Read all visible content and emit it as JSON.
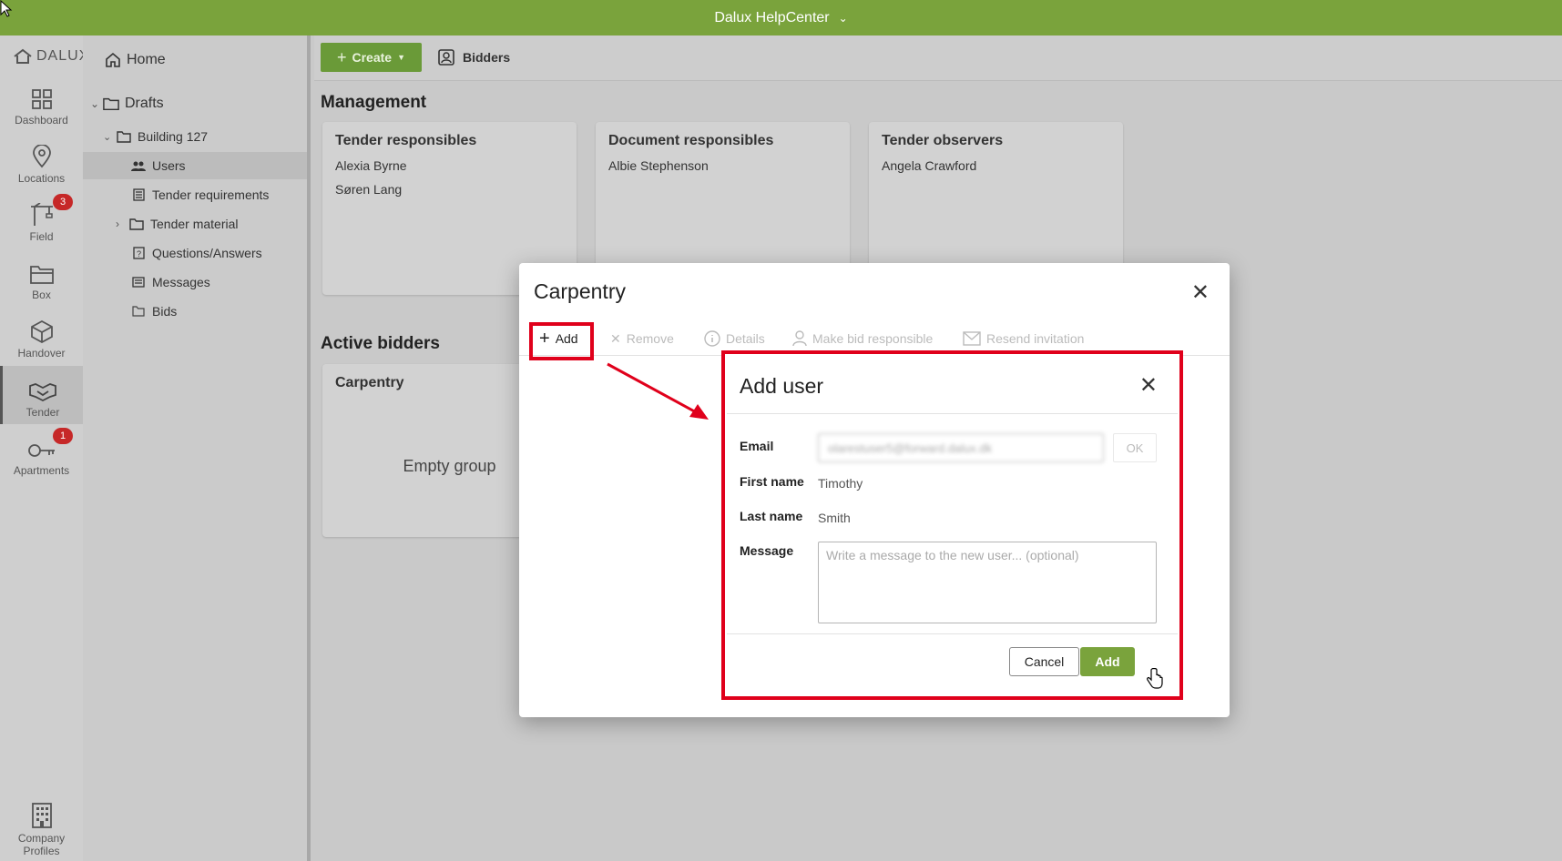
{
  "topbar": {
    "title": "Dalux HelpCenter"
  },
  "rail": {
    "logo": "DALUX",
    "items": [
      {
        "label": "Dashboard"
      },
      {
        "label": "Locations"
      },
      {
        "label": "Field",
        "badge": "3"
      },
      {
        "label": "Box"
      },
      {
        "label": "Handover"
      },
      {
        "label": "Tender"
      },
      {
        "label": "Apartments",
        "badge": "1"
      }
    ],
    "bottom_line1": "Company",
    "bottom_line2": "Profiles"
  },
  "tree": {
    "home": "Home",
    "drafts": "Drafts",
    "building": "Building 127",
    "users": "Users",
    "tender_requirements": "Tender requirements",
    "tender_material": "Tender material",
    "questions": "Questions/Answers",
    "messages": "Messages",
    "bids": "Bids"
  },
  "toolbar": {
    "create": "Create",
    "bidders": "Bidders"
  },
  "management": {
    "title": "Management",
    "cards": [
      {
        "title": "Tender responsibles",
        "people": [
          "Alexia Byrne",
          "Søren Lang"
        ]
      },
      {
        "title": "Document responsibles",
        "people": [
          "Albie Stephenson"
        ]
      },
      {
        "title": "Tender observers",
        "people": [
          "Angela Crawford"
        ]
      }
    ]
  },
  "active_bidders": {
    "title": "Active bidders",
    "card_title": "Carpentry",
    "empty": "Empty group"
  },
  "carpentry_modal": {
    "title": "Carpentry",
    "tools": {
      "add": "Add",
      "remove": "Remove",
      "details": "Details",
      "make_bid_responsible": "Make bid responsible",
      "resend_invitation": "Resend invitation"
    }
  },
  "add_user": {
    "title": "Add user",
    "email_label": "Email",
    "email_value": "olarestuser5@forward.dalux.dk",
    "ok": "OK",
    "first_name_label": "First name",
    "first_name": "Timothy",
    "last_name_label": "Last name",
    "last_name": "Smith",
    "message_label": "Message",
    "message_placeholder": "Write a message to the new user... (optional)",
    "cancel": "Cancel",
    "add": "Add"
  },
  "colors": {
    "brand": "#7aa33c",
    "highlight": "#e0001b",
    "badge": "#c62828"
  }
}
